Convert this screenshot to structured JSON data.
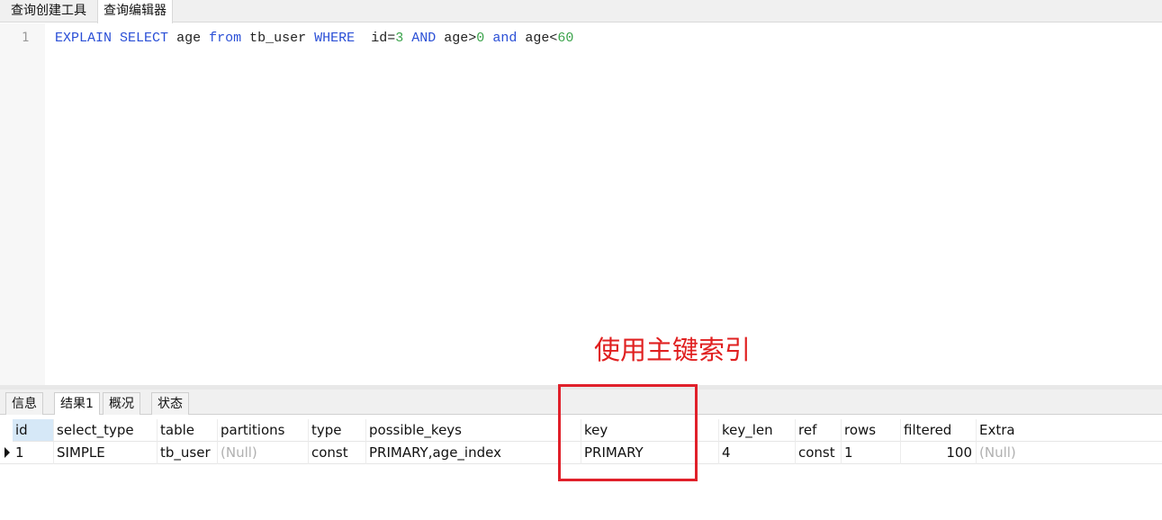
{
  "top_tabs": [
    "查询创建工具",
    "查询编辑器"
  ],
  "editor": {
    "line_number": "1",
    "sql": {
      "explain": "EXPLAIN",
      "select": "SELECT",
      "col": "age",
      "from": "from",
      "table": "tb_user",
      "where": "WHERE",
      "c1a": "id=",
      "c1b": "3",
      "and1": "AND",
      "c2a": "age>",
      "c2b": "0",
      "and2": "and",
      "c3a": "age<",
      "c3b": "60"
    }
  },
  "annotation": "使用主键索引",
  "result_tabs": [
    "信息",
    "结果1",
    "概况",
    "状态"
  ],
  "grid": {
    "columns": [
      "id",
      "select_type",
      "table",
      "partitions",
      "type",
      "possible_keys",
      "key",
      "key_len",
      "ref",
      "rows",
      "filtered",
      "Extra"
    ],
    "row": [
      "1",
      "SIMPLE",
      "tb_user",
      "(Null)",
      "const",
      "PRIMARY,age_index",
      "PRIMARY",
      "4",
      "const",
      "1",
      "100",
      "(Null)"
    ]
  },
  "colors": {
    "keyword": "#2a4fd6",
    "number": "#3aa34a",
    "annotation": "#e02020",
    "null_text": "#b0b0b0"
  }
}
